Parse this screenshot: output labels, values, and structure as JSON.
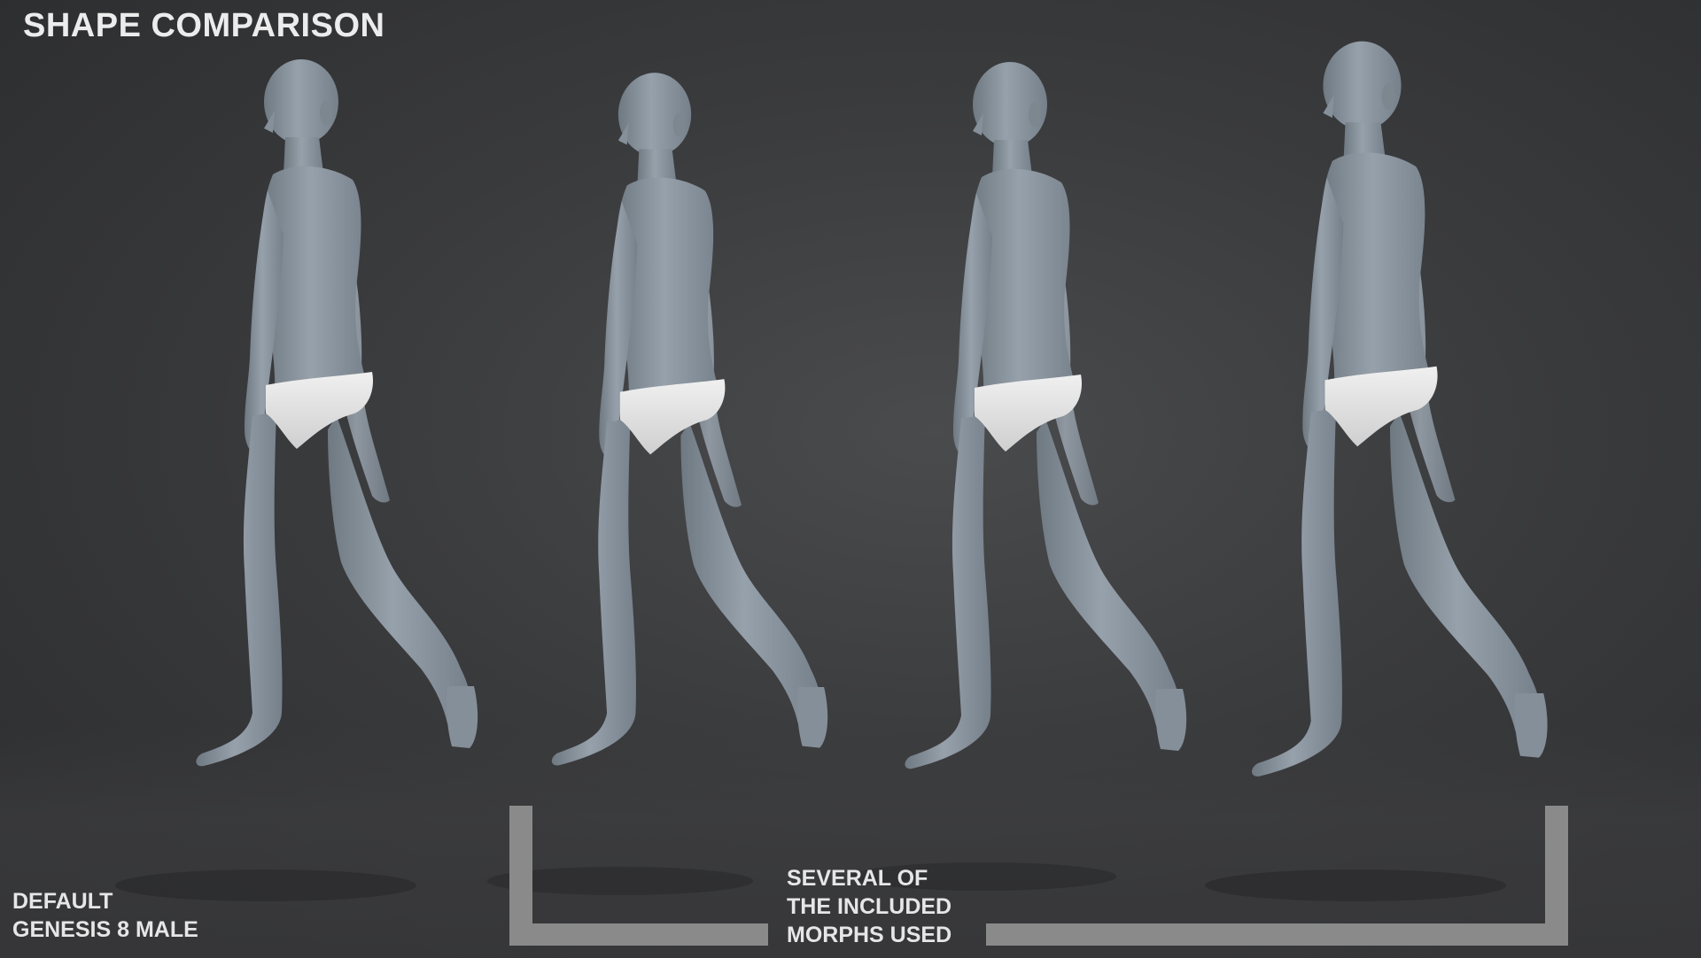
{
  "title": "SHAPE COMPARISON",
  "labels": {
    "default": [
      "DEFAULT",
      "GENESIS 8 MALE"
    ],
    "morphs": [
      "SEVERAL OF",
      "THE INCLUDED",
      "MORPHS USED"
    ]
  },
  "colors": {
    "background": "#38393b",
    "skin": "#8a949e",
    "briefs": "#e4e4e4",
    "bracket": "#8a8a8a",
    "text": "#e6e6e6"
  },
  "figures": [
    {
      "name": "default-genesis-8-male"
    },
    {
      "name": "morph-figure-1"
    },
    {
      "name": "morph-figure-2"
    },
    {
      "name": "morph-figure-3"
    }
  ]
}
